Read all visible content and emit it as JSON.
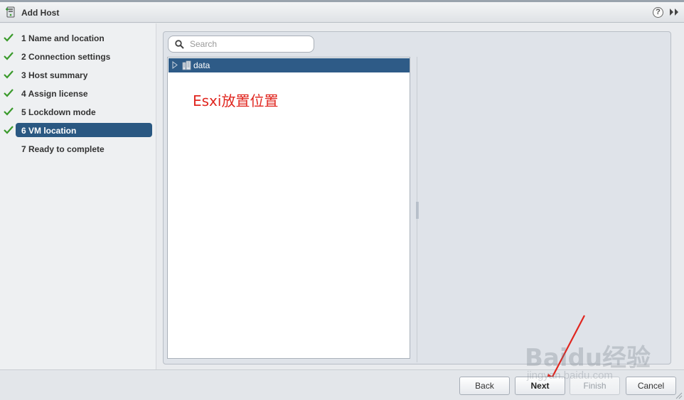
{
  "window": {
    "title": "Add Host",
    "help_icon": "help-icon",
    "expand_icon": "double-chevron-right-icon"
  },
  "steps": [
    {
      "label": "1  Name and location",
      "completed": true,
      "active": false
    },
    {
      "label": "2  Connection settings",
      "completed": true,
      "active": false
    },
    {
      "label": "3  Host summary",
      "completed": true,
      "active": false
    },
    {
      "label": "4  Assign license",
      "completed": true,
      "active": false
    },
    {
      "label": "5  Lockdown mode",
      "completed": true,
      "active": false
    },
    {
      "label": "6  VM location",
      "completed": true,
      "active": true
    },
    {
      "label": "7  Ready to complete",
      "completed": false,
      "active": false
    }
  ],
  "search": {
    "placeholder": "Search",
    "value": ""
  },
  "tree": {
    "items": [
      {
        "label": "data",
        "icon": "datacenter-icon",
        "expanded": false,
        "selected": true
      }
    ]
  },
  "annotation": {
    "text": "Esxi放置位置",
    "color": "#e0261f"
  },
  "footer": {
    "back_label": "Back",
    "next_label": "Next",
    "finish_label": "Finish",
    "cancel_label": "Cancel",
    "finish_enabled": false
  },
  "watermark": {
    "logo_text": "Baidu经验",
    "url_text": "jingyan.baidu.com"
  },
  "colors": {
    "accent": "#2a5882",
    "check": "#3a9a2b",
    "sidebar_bg": "#eef0f2",
    "panel_bg": "#dfe3e9"
  }
}
